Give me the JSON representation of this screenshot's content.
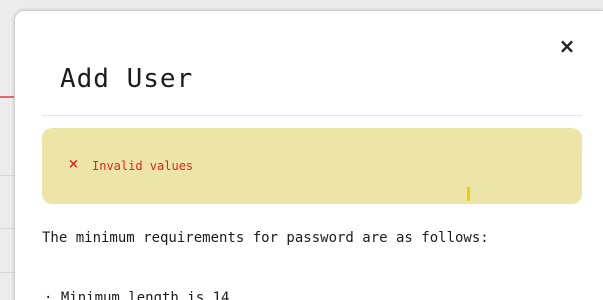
{
  "modal": {
    "title": "Add User",
    "close_glyph": "×",
    "close_icon": "close-icon",
    "alert": {
      "icon_glyph": "×",
      "icon": "error-x-icon",
      "message": "Invalid values",
      "background_color": "#ede5a8",
      "text_color": "#e02424"
    },
    "requirements_intro": "The minimum requirements for password are as follows:",
    "requirements_items": [
      "· Minimum length is 14"
    ]
  }
}
